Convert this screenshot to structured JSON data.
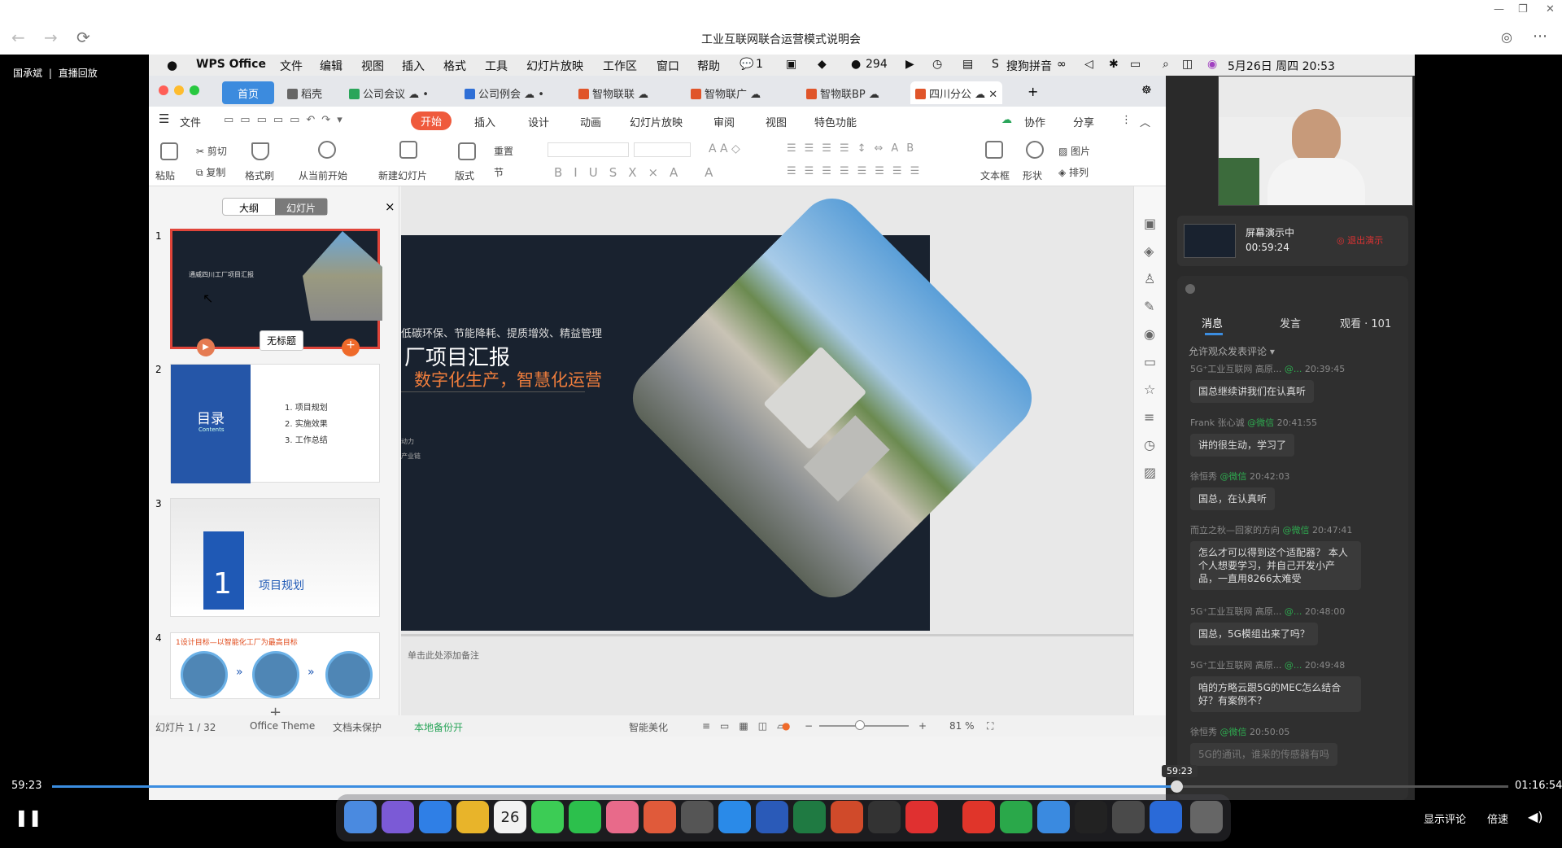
{
  "browser": {
    "title": "工业互联网联合运营模式说明会",
    "back_icon": "arrow-left-icon",
    "forward_icon": "arrow-right-icon",
    "reload_icon": "reload-icon"
  },
  "streamer": {
    "name": "国承斌",
    "separator": "|",
    "mode": "直播回放"
  },
  "macmenu": {
    "app": "WPS Office",
    "items": [
      "文件",
      "编辑",
      "视图",
      "插入",
      "格式",
      "工具",
      "幻灯片放映",
      "工作区",
      "窗口",
      "帮助"
    ],
    "badge1": "1",
    "badge2": "294",
    "ime": "搜狗拼音",
    "clock": "5月26日 周四 20:53"
  },
  "wps_tabs": [
    {
      "label": "首页",
      "color": "#aaaaaa"
    },
    {
      "label": "稻壳",
      "color": "#666666"
    },
    {
      "label": "公司会议",
      "color": "#2aa55a"
    },
    {
      "label": "公司例会",
      "color": "#2f6fd6"
    },
    {
      "label": "智物联联",
      "color": "#e0552a"
    },
    {
      "label": "智物联广",
      "color": "#e0552a"
    },
    {
      "label": "智物联BP",
      "color": "#e0552a"
    },
    {
      "label": "四川分公",
      "color": "#e0552a"
    }
  ],
  "mainmenu": {
    "file": "文件",
    "start": "开始",
    "items": [
      "插入",
      "设计",
      "动画",
      "幻灯片放映",
      "审阅",
      "视图",
      "特色功能"
    ],
    "collab": "协作",
    "share": "分享"
  },
  "ribbon": {
    "paste": "粘贴",
    "cut": "剪切",
    "copy": "复制",
    "format_painter": "格式刷",
    "play_from_current": "从当前开始",
    "new_slide": "新建幻灯片",
    "layout": "版式",
    "reset": "重置",
    "section": "节",
    "textbox": "文本框",
    "shape": "形状",
    "picture": "图片",
    "arrange": "排列"
  },
  "panel": {
    "outline": "大纲",
    "slides": "幻灯片",
    "close": "×",
    "tooltip": "无标题"
  },
  "thumbs": {
    "t1_title": "通威四川工厂项目汇报",
    "t2_heading": "目录",
    "t2_sub": "Contents",
    "t2_items": [
      "1. 项目规划",
      "2. 实施效果",
      "3. 工作总结"
    ],
    "t3_num": "1",
    "t3_title": "项目规划",
    "t4_title": "1设计目标—以智能化工厂为最高目标",
    "add": "+"
  },
  "slide": {
    "line1": "低碳环保、节能降耗、提质增效、精益管理",
    "title": "厂项目汇报",
    "subtitle": "数字化生产，智慧化运营",
    "note1": "动力",
    "note2": "产业链"
  },
  "notes_placeholder": "单击此处添加备注",
  "status": {
    "slide_no": "幻灯片 1 / 32",
    "theme": "Office Theme",
    "protect": "文档未保护",
    "backup": "本地备份开",
    "beautify": "智能美化",
    "zoom": "81 %"
  },
  "present": {
    "label": "屏幕演示中",
    "time": "00:59:24",
    "exit": "退出演示"
  },
  "chat": {
    "tabs": [
      "消息",
      "发言",
      "观看 · 101"
    ],
    "allow": "允许观众发表评论",
    "messages": [
      {
        "name": "5G⁺工业互联网 高原...",
        "tag": "@...",
        "time": "20:39:45",
        "text": "国总继续讲我们在认真听"
      },
      {
        "name": "Frank 张心诚",
        "tag": "@微信",
        "time": "20:41:55",
        "text": "讲的很生动，学习了"
      },
      {
        "name": "徐恒秀",
        "tag": "@微信",
        "time": "20:42:03",
        "text": "国总，在认真听"
      },
      {
        "name": "而立之秋—回家的方向",
        "tag": "@微信",
        "time": "20:47:41",
        "text": "怎么才可以得到这个适配器？ 本人个人想要学习，并自己开发小产品，一直用8266太难受"
      },
      {
        "name": "5G⁺工业互联网 高原...",
        "tag": "@...",
        "time": "20:48:00",
        "text": "国总，5G模组出来了吗？"
      },
      {
        "name": "5G⁺工业互联网 高原...",
        "tag": "@...",
        "time": "20:49:48",
        "text": "咱的方略云跟5G的MEC怎么结合好？有案例不？"
      },
      {
        "name": "徐恒秀",
        "tag": "@微信",
        "time": "20:50:05",
        "text": "5G的通讯，谁采的传感器有吗"
      }
    ]
  },
  "player": {
    "current": "59:23",
    "total": "01:16:54",
    "hover": "59:23",
    "progress_fraction": 0.772,
    "show_comments": "显示评论",
    "speed": "倍速"
  },
  "dock_date": "26"
}
